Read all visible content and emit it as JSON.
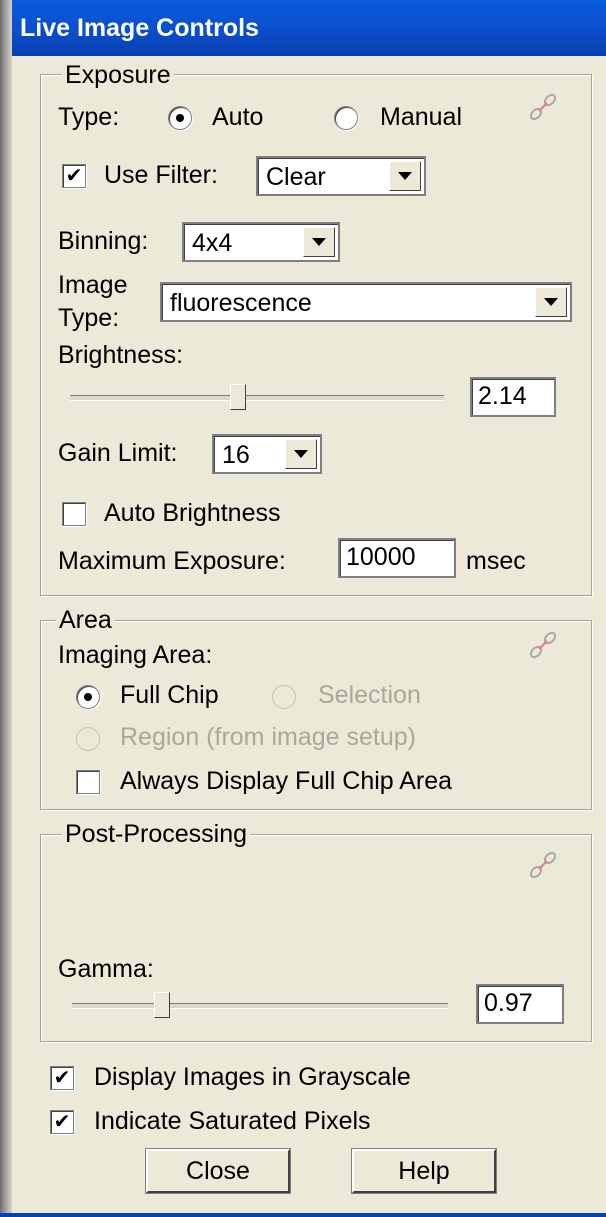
{
  "window": {
    "title": "Live Image Controls"
  },
  "exposure": {
    "legend": "Exposure",
    "type_label": "Type:",
    "type_options": [
      "Auto",
      "Manual"
    ],
    "type_selected": "Auto",
    "link_icon": "link-icon",
    "use_filter": {
      "label": "Use Filter:",
      "checked": true,
      "value": "Clear"
    },
    "binning": {
      "label": "Binning:",
      "value": "4x4"
    },
    "image_type": {
      "label_line1": "Image",
      "label_line2": "Type:",
      "value": "fluorescence"
    },
    "brightness": {
      "label": "Brightness:",
      "value": "2.14",
      "slider_fraction": 0.47
    },
    "gain_limit": {
      "label": "Gain Limit:",
      "value": "16"
    },
    "auto_brightness": {
      "label": "Auto Brightness",
      "checked": false
    },
    "max_exposure": {
      "label": "Maximum Exposure:",
      "value": "10000",
      "unit": "msec"
    }
  },
  "area": {
    "legend": "Area",
    "imaging_area_label": "Imaging Area:",
    "options": [
      {
        "label": "Full Chip",
        "selected": true,
        "enabled": true
      },
      {
        "label": "Selection",
        "selected": false,
        "enabled": false
      },
      {
        "label": "Region (from image setup)",
        "selected": false,
        "enabled": false
      }
    ],
    "always_display": {
      "label": "Always Display Full Chip Area",
      "checked": false
    }
  },
  "post_processing": {
    "legend": "Post-Processing",
    "gamma": {
      "label": "Gamma:",
      "value": "0.97",
      "slider_fraction": 0.24
    }
  },
  "display_grayscale": {
    "label": "Display Images in Grayscale",
    "checked": true
  },
  "indicate_saturated": {
    "label": "Indicate Saturated Pixels",
    "checked": true
  },
  "buttons": {
    "close": "Close",
    "help": "Help"
  }
}
